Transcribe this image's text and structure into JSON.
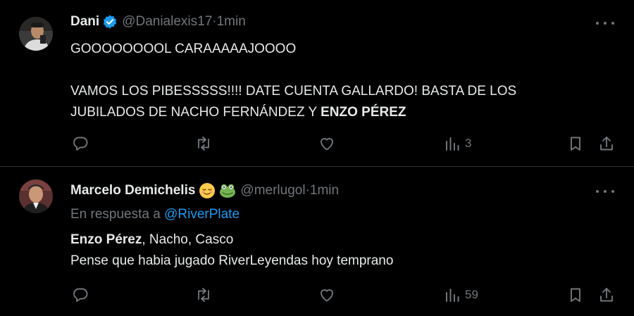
{
  "tweets": [
    {
      "name": "Dani",
      "handle": "@Danialexis17",
      "time": "1min",
      "verified": true,
      "text_line1": "GOOOOOOOOL CARAAAAAJOOOO",
      "text_line2": "VAMOS LOS PIBESSSSS!!!! DATE CUENTA GALLARDO! BASTA DE LOS",
      "text_line3_plain": "JUBILADOS DE NACHO FERNÁNDEZ Y ",
      "text_line3_bold": "ENZO PÉREZ",
      "views": "3",
      "icons": [
        "reply-icon",
        "retweet-icon",
        "like-icon",
        "views-icon",
        "bookmark-icon",
        "share-icon",
        "more-icon"
      ]
    },
    {
      "name": "Marcelo Demichelis",
      "emojis": [
        "relieved-face",
        "frog-face"
      ],
      "handle": "@merlugol",
      "time": "1min",
      "replying_prefix": "En respuesta a ",
      "replying_to": "@RiverPlate",
      "text_line1_bold": "Enzo Pérez",
      "text_line1_plain": ", Nacho, Casco",
      "text_line2": "Pense que habia jugado RiverLeyendas hoy temprano",
      "views": "59",
      "icons": [
        "reply-icon",
        "retweet-icon",
        "like-icon",
        "views-icon",
        "bookmark-icon",
        "share-icon",
        "more-icon"
      ]
    }
  ],
  "separator": " · ",
  "colors": {
    "background": "#000000",
    "text": "#e7e9ea",
    "muted": "#71767b",
    "link": "#1d9bf0",
    "border": "#2f3336",
    "verified": "#1d9bf0"
  }
}
